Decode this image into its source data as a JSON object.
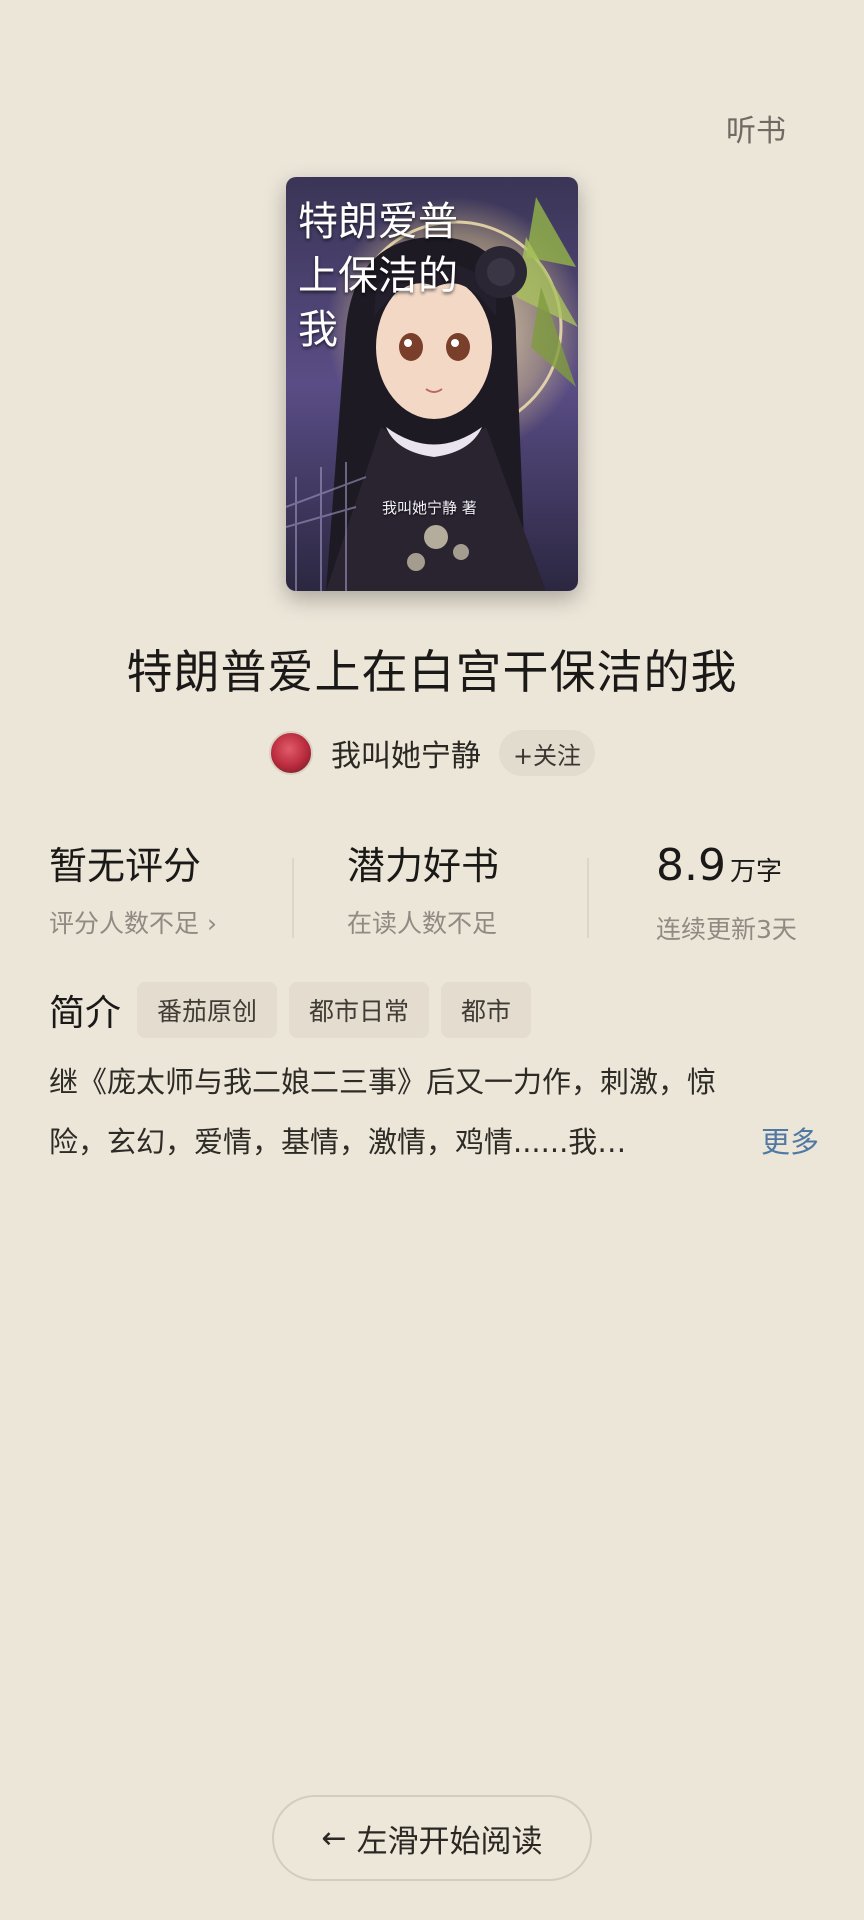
{
  "header": {
    "listen_label": "听书"
  },
  "cover": {
    "title_lines": [
      "特朗爱普",
      "上保洁的",
      "我"
    ],
    "author_credit": "我叫她宁静 著"
  },
  "book": {
    "title": "特朗普爱上在白宫干保洁的我",
    "author": "我叫她宁静",
    "follow_label": "+关注"
  },
  "stats": {
    "rating": {
      "main": "暂无评分",
      "sub": "评分人数不足 ›"
    },
    "potential": {
      "main": "潜力好书",
      "sub": "在读人数不足"
    },
    "words": {
      "number": "8.9",
      "unit": "万字",
      "sub": "连续更新3天"
    }
  },
  "intro": {
    "label": "简介",
    "tags": [
      "番茄原创",
      "都市日常",
      "都市"
    ],
    "line1": "继《庞太师与我二娘二三事》后又一力作，刺激，惊",
    "line2": "险，玄幻，爱情，基情，激情，鸡情......我…",
    "more_label": "更多"
  },
  "footer": {
    "start_label": "左滑开始阅读"
  },
  "colors": {
    "background": "#ece6d9",
    "link": "#4f78a2",
    "tag_bg": "#e4ddcf"
  }
}
